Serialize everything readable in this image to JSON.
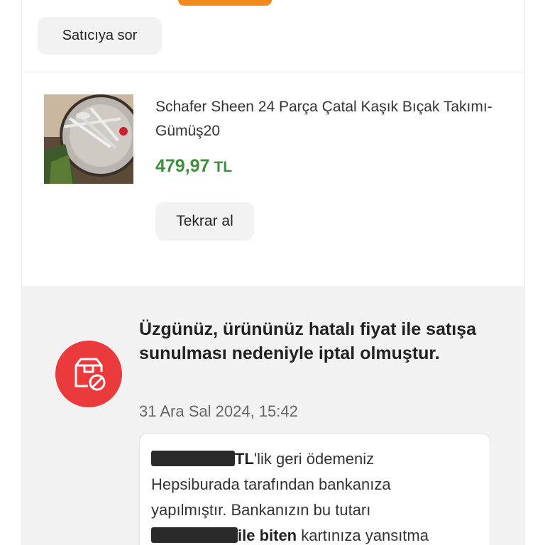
{
  "order": {
    "ask_seller_label": "Satıcıya sor",
    "product": {
      "name": "Schafer Sheen 24 Parça Çatal Kaşık Bıçak Takımı-Gümüş20",
      "price": "479,97",
      "currency": "TL",
      "rebuy_label": "Tekrar al"
    }
  },
  "cancellation": {
    "icon": "box-cancel-icon",
    "title": "Üzgünüz, ürününüz hatalı fiyat ile satışa sunulması nedeniyle iptal olmuştur.",
    "date": "31 Ara Sal 2024, 15:42",
    "refund": {
      "amount_suffix": "TL",
      "line1_rest": "'lik geri ödemeniz",
      "line2": "Hepsiburada tarafından bankanıza",
      "line3": "yapılmıştır. Bankanızın bu tutarı",
      "card_suffix": "ile biten",
      "line4_rest": " kartınıza yansıtma"
    }
  },
  "colors": {
    "accent_orange": "#f28b1c",
    "price_green": "#3e8f3b",
    "cancel_red": "#ea3a3c",
    "panel_gray": "#f2f2f2"
  }
}
